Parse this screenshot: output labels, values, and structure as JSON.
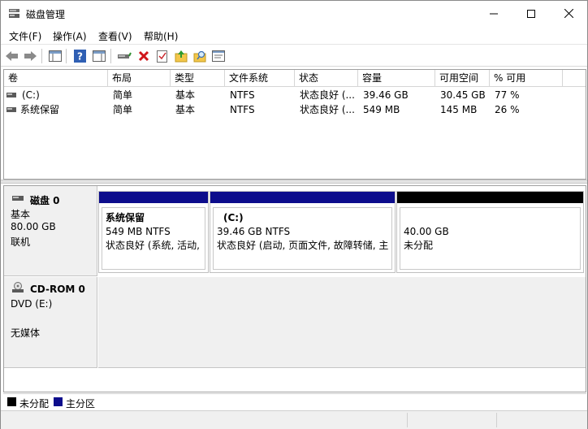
{
  "window": {
    "title": "磁盘管理"
  },
  "menu": [
    "文件(F)",
    "操作(A)",
    "查看(V)",
    "帮助(H)"
  ],
  "toolbar": {
    "icons": [
      "back-arrow-icon",
      "forward-arrow-icon",
      "console-tree-icon",
      "help-icon",
      "action-pane-icon",
      "connect-drive-icon",
      "delete-icon",
      "checkmark-icon",
      "open-folder-up-icon",
      "search-folder-icon",
      "properties-icon"
    ]
  },
  "volume_table": {
    "columns": [
      "卷",
      "布局",
      "类型",
      "文件系统",
      "状态",
      "容量",
      "可用空间",
      "% 可用"
    ],
    "rows": [
      {
        "volume": "(C:)",
        "layout": "简单",
        "type": "基本",
        "fs": "NTFS",
        "status": "状态良好 (...",
        "capacity": "39.46 GB",
        "free": "30.45 GB",
        "pct": "77 %"
      },
      {
        "volume": "系统保留",
        "layout": "简单",
        "type": "基本",
        "fs": "NTFS",
        "status": "状态良好 (...",
        "capacity": "549 MB",
        "free": "145 MB",
        "pct": "26 %"
      }
    ]
  },
  "disks": {
    "disk0": {
      "name": "磁盘 0",
      "type": "基本",
      "size": "80.00 GB",
      "state": "联机",
      "partitions": [
        {
          "name": "系统保留",
          "size": "549 MB NTFS",
          "status": "状态良好 (系统, 活动, 主分区)",
          "color": "#0d0d8c"
        },
        {
          "name": "(C:)",
          "size": "39.46 GB NTFS",
          "status": "状态良好 (启动, 页面文件, 故障转储, 主分区)",
          "color": "#0d0d8c"
        },
        {
          "name": "",
          "size": "40.00 GB",
          "status": "未分配",
          "color": "#000000"
        }
      ]
    },
    "cdrom0": {
      "name": "CD-ROM 0",
      "drive": "DVD (E:)",
      "media": "无媒体"
    }
  },
  "legend": [
    {
      "label": "未分配",
      "color": "#000000"
    },
    {
      "label": "主分区",
      "color": "#0d0d8c"
    }
  ]
}
